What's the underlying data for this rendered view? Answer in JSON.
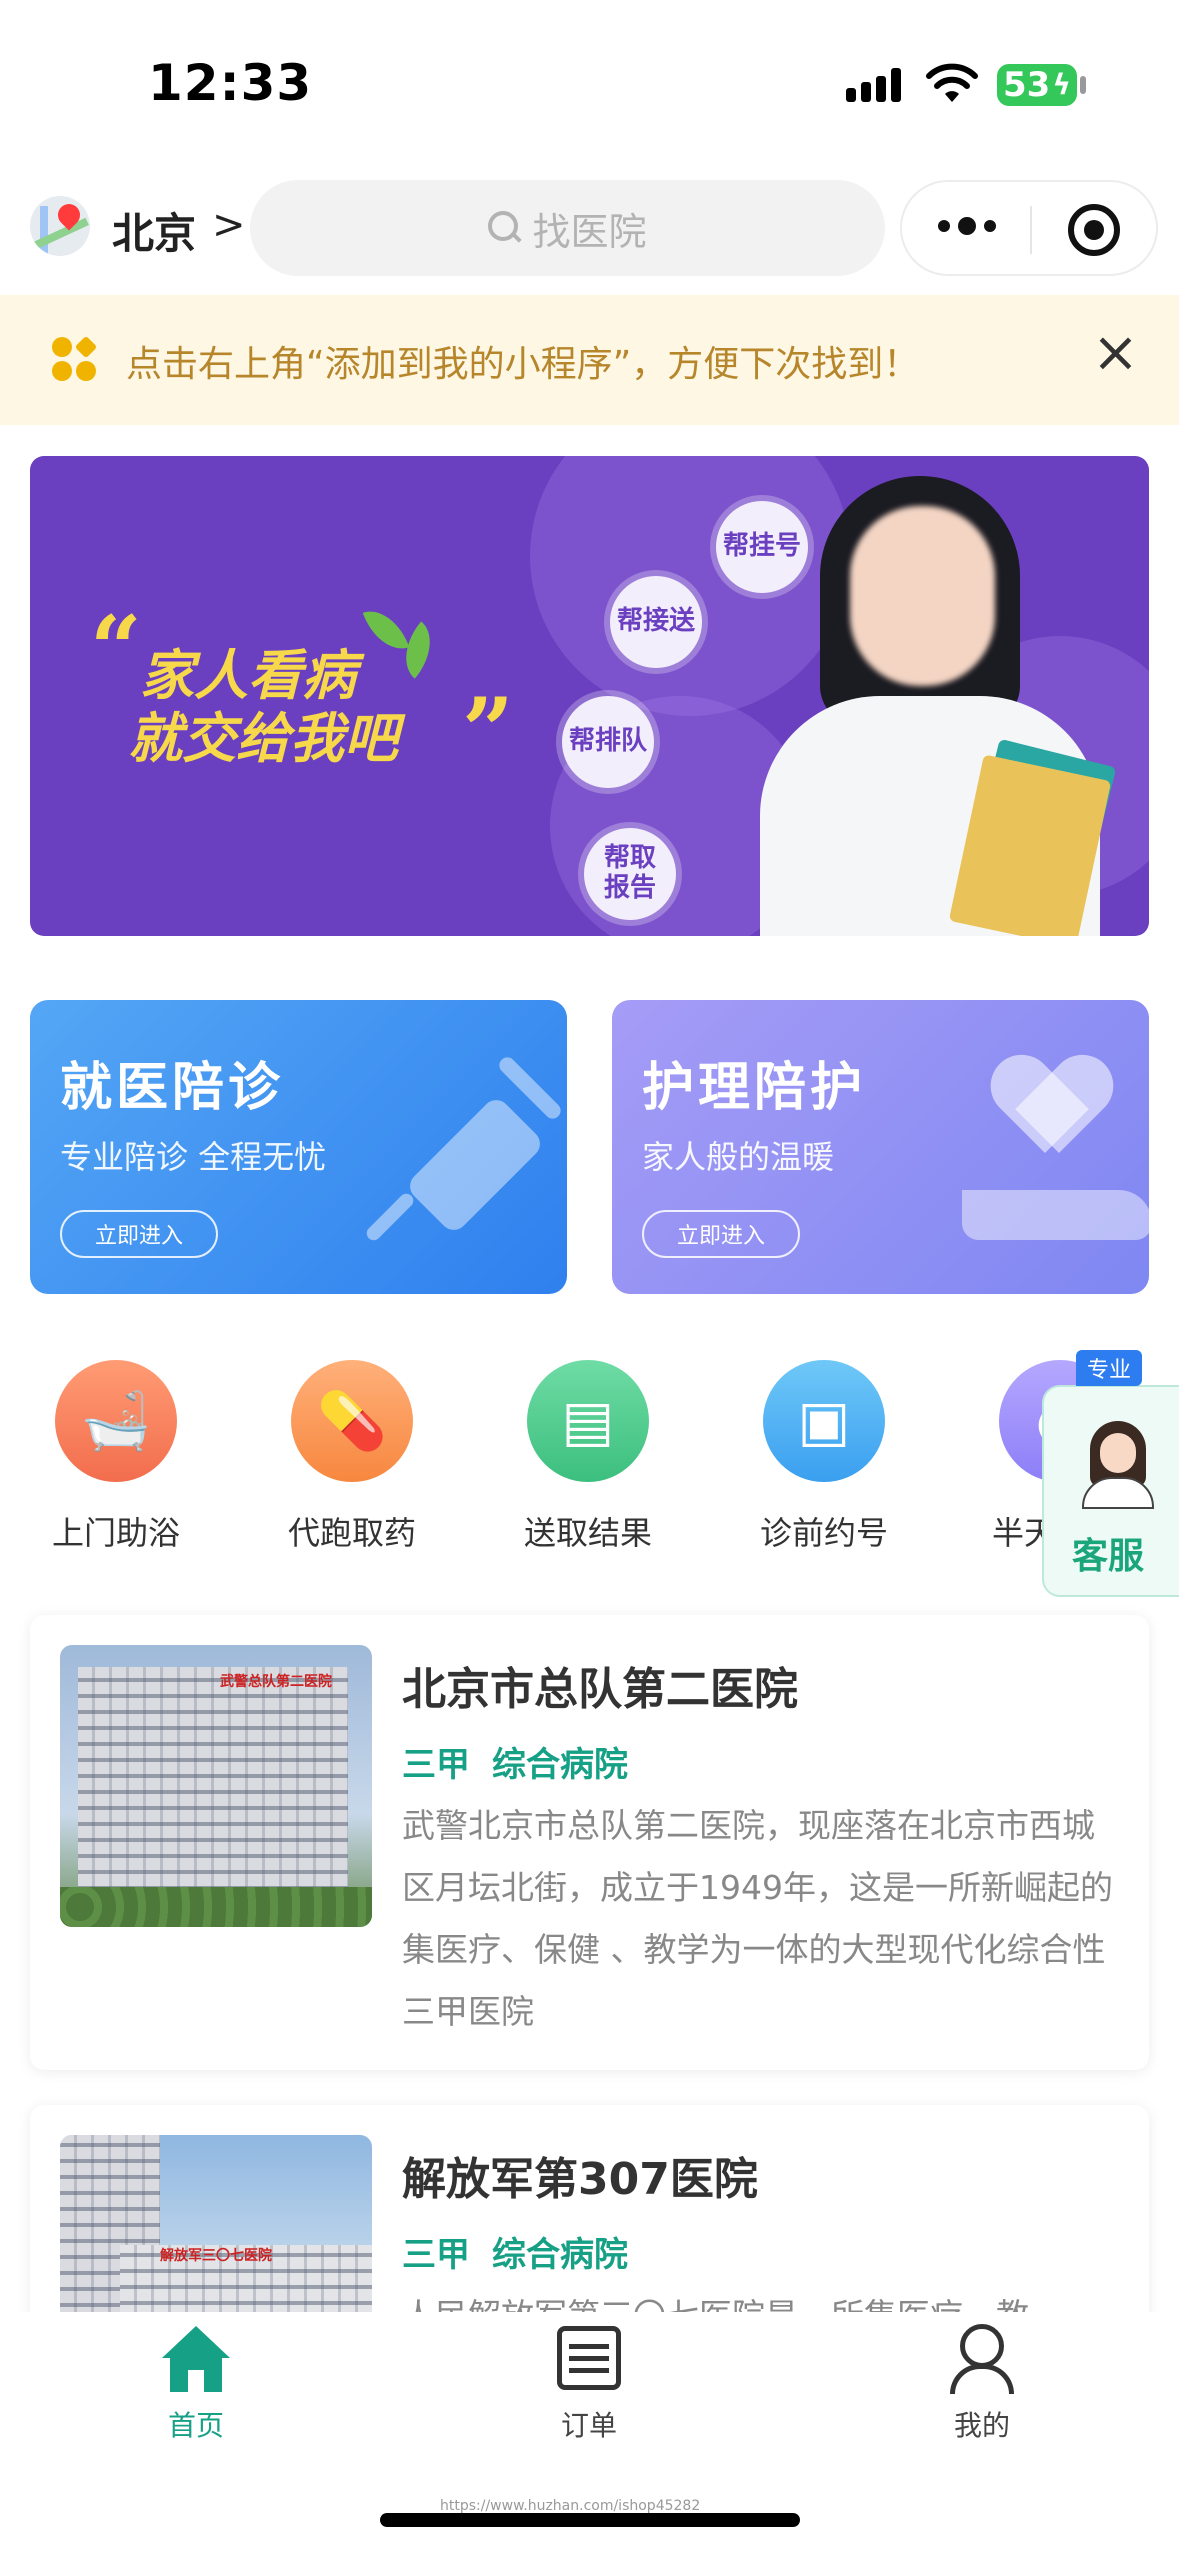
{
  "status_bar": {
    "time": "12:33",
    "battery": "53"
  },
  "nav": {
    "city": "北京",
    "city_chevron": ">",
    "search_placeholder": "找医院"
  },
  "notice": {
    "text": "点击右上角“添加到我的小程序”，方便下次找到！",
    "close": "×"
  },
  "banner": {
    "line1": "家人看病",
    "line2": "就交给我吧",
    "bubbles": [
      "帮挂号",
      "帮接送",
      "帮排队",
      "帮取\n报告"
    ]
  },
  "service_cards": [
    {
      "title": "就医陪诊",
      "subtitle": "专业陪诊 全程无忧",
      "button": "立即进入",
      "icon": "syringe-icon"
    },
    {
      "title": "护理陪护",
      "subtitle": "家人般的温暖",
      "button": "立即进入",
      "icon": "heart-hand-icon"
    }
  ],
  "quick_services": [
    {
      "label": "上门助浴",
      "icon": "bathtub-icon",
      "color": "#f26d4d"
    },
    {
      "label": "代跑取药",
      "icon": "medicine-bag-icon",
      "color": "#f7873f"
    },
    {
      "label": "送取结果",
      "icon": "report-icon",
      "color": "#3cbf7e"
    },
    {
      "label": "诊前约号",
      "icon": "monitor-icon",
      "color": "#3a9ff0"
    },
    {
      "label": "半天",
      "icon": "half-day-icon",
      "color": "#8c7ef7"
    }
  ],
  "customer_service": {
    "badge": "专业",
    "label": "客服"
  },
  "hospitals": [
    {
      "name": "北京市总队第二医院",
      "tags": [
        "三甲",
        "综合病院"
      ],
      "description": "武警北京市总队第二医院，现座落在北京市西城区月坛北街，成立于1949年，这是一所新崛起的集医疗、保健 、教学为一体的大型现代化综合性三甲医院",
      "sign": "武警总队第二医院"
    },
    {
      "name": "解放军第307医院",
      "tags": [
        "三甲",
        "综合病院"
      ],
      "description": "人民解放军第三〇七医院是一所集医疗、教",
      "sign": "解放军三〇七医院"
    }
  ],
  "tabs": [
    {
      "label": "首页",
      "icon": "home-icon",
      "active": true
    },
    {
      "label": "订单",
      "icon": "order-icon",
      "active": false
    },
    {
      "label": "我的",
      "icon": "profile-icon",
      "active": false
    }
  ],
  "watermark": "https://www.huzhan.com/ishop45282",
  "colors": {
    "accent": "#16a085",
    "notice_bg": "#fdf7e4",
    "notice_text": "#b7852a",
    "banner_bg": "#6a3fc0",
    "banner_text": "#f6d84a"
  }
}
